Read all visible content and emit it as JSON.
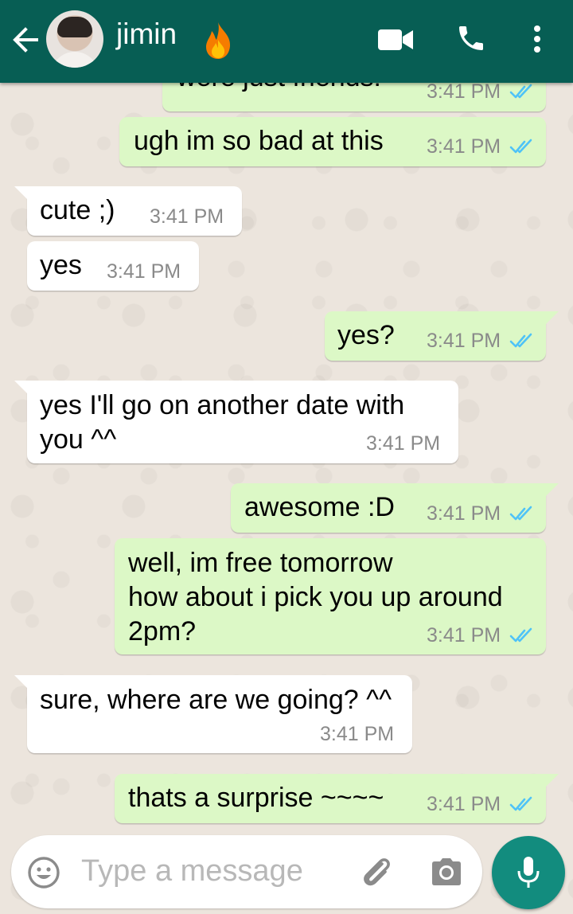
{
  "header": {
    "contact_name": "jimin",
    "icons": [
      "back-arrow-icon",
      "avatar",
      "fire-emoji-icon",
      "video-call-icon",
      "voice-call-icon",
      "more-options-icon"
    ],
    "color": "#075e54"
  },
  "messages": [
    {
      "dir": "out",
      "text": "were just friends!",
      "time": "3:41 PM",
      "read": true
    },
    {
      "dir": "out",
      "text": "ugh im so bad at this",
      "time": "3:41 PM",
      "read": true
    },
    {
      "dir": "in",
      "text": "cute ;)",
      "time": "3:41 PM"
    },
    {
      "dir": "in",
      "text": "yes",
      "time": "3:41 PM"
    },
    {
      "dir": "out",
      "text": "yes?",
      "time": "3:41 PM",
      "read": true
    },
    {
      "dir": "in",
      "text": "yes I'll go on another date with\nyou ^^",
      "time": "3:41 PM"
    },
    {
      "dir": "out",
      "text": "awesome :D",
      "time": "3:41 PM",
      "read": true
    },
    {
      "dir": "out",
      "text": "well, im free tomorrow\nhow about i pick you up around\n2pm?",
      "time": "3:41 PM",
      "read": true
    },
    {
      "dir": "in",
      "text": "sure, where are we going? ^^",
      "time": "3:41 PM"
    },
    {
      "dir": "out",
      "text": "thats a surprise ~~~~",
      "time": "3:41 PM",
      "read": true
    }
  ],
  "composer": {
    "placeholder": "Type a message",
    "icons": [
      "emoji-icon",
      "attach-icon",
      "camera-icon",
      "mic-icon"
    ]
  },
  "colors": {
    "outgoing_bubble": "#dcf8c6",
    "incoming_bubble": "#ffffff",
    "read_ticks": "#4fc3f7",
    "send_button": "#128c7e"
  }
}
